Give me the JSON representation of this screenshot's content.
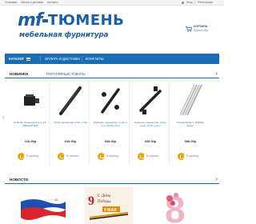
{
  "topbar": {
    "links": [
      "Установка",
      "Оплата и доставка",
      "Контакты"
    ],
    "login": "Вход",
    "register": "Регистрация"
  },
  "header": {
    "logo_mark": "mf",
    "logo_city": "ТЮМЕНЬ",
    "logo_tagline": "мебельная фурнитура",
    "cart_title": "КОРЗИНА",
    "cart_sum": "Пусто 0.00р"
  },
  "nav": {
    "catalog": "КАТАЛОГ",
    "items": [
      "ОПЛАТА И ДОСТАВКА",
      "КОНТАКТЫ"
    ]
  },
  "new_section": {
    "title": "НОВИНКИ",
    "tab": "ПОПУЛЯРНЫЕ ТОВАРЫ",
    "buy_label": "В корзину",
    "products": [
      {
        "name": "D-60 Фл Ограничитель 1 хеб, ЧЕРНЫЙ МАТ",
        "price": "116.00р"
      },
      {
        "name": "Труба черный мат d=16, L=3м",
        "price": "649.00р"
      },
      {
        "name": "Комплект черный мат трубы и 2 шт d=16 L=3 м",
        "price": "549.00р"
      },
      {
        "name": "Комплект черный мат трубы держ. d=16, L=3 м",
        "price": "339.00р"
      },
      {
        "name": "Планка 16 DL 1, 3000мм, алюм.",
        "price": "396.00р"
      }
    ]
  },
  "news_section": {
    "title": "НОВОСТИ",
    "card_texts": [
      "С Днём",
      "Победы",
      "9 МАЯ",
      "8"
    ]
  },
  "colors": {
    "brand": "#1a6db3",
    "accent": "#f0a400"
  }
}
